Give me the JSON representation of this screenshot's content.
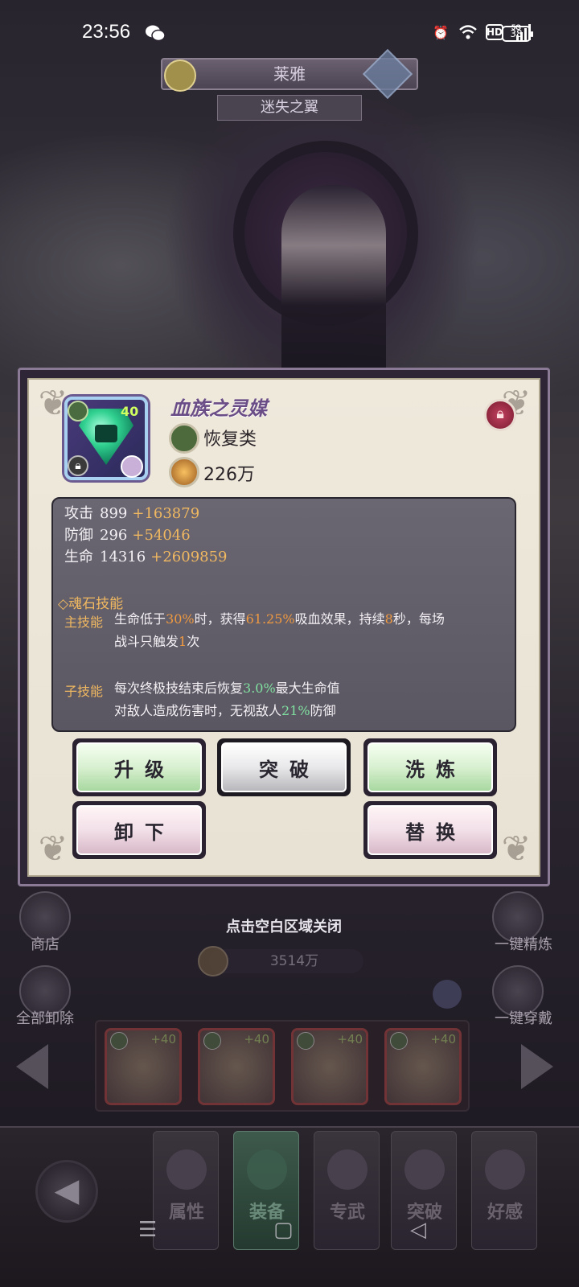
{
  "status_bar": {
    "time": "23:56",
    "battery": "38",
    "icons": [
      "wechat-icon",
      "alarm-icon",
      "wifi-icon",
      "hd-icon",
      "5g-signal-icon",
      "battery-icon"
    ]
  },
  "hero": {
    "name": "莱雅",
    "title": "迷失之翼"
  },
  "item": {
    "name": "血族之灵媒",
    "level": "40",
    "type": "恢复类",
    "power": "226万",
    "accent_color": "#6a4c86"
  },
  "stats": [
    {
      "label": "攻击",
      "base": "899",
      "bonus": "+163879"
    },
    {
      "label": "防御",
      "base": "296",
      "bonus": "+54046"
    },
    {
      "label": "生命",
      "base": "14316",
      "bonus": "+2609859"
    }
  ],
  "skills": {
    "section_title": "◇魂石技能",
    "main_label": "主技能",
    "main_parts": {
      "p1": "生命低于",
      "v1": "30%",
      "p2": "时，获得",
      "v2": "61.25%",
      "p3": "吸血效果，持续",
      "v3": "8",
      "p4": "秒，每场",
      "p5": "战斗只触发",
      "v4": "1",
      "p6": "次"
    },
    "sub_label": "子技能",
    "sub_parts": {
      "p1": "每次终极技结束后恢复",
      "v1": "3.0%",
      "p2": "最大生命值",
      "p3": "对敌人造成伤害时，无视敌人",
      "v2": "21%",
      "p4": "防御"
    }
  },
  "buttons": {
    "upgrade": "升级",
    "breakthrough": "突破",
    "refine": "洗炼",
    "unequip": "卸下",
    "replace": "替换"
  },
  "hint": "点击空白区域关闭",
  "side": {
    "shop": "商店",
    "remove_all": "全部卸除",
    "one_click_refine": "一键精炼",
    "one_click_equip": "一键穿戴"
  },
  "total_power": "3514万",
  "equip_slots": [
    {
      "level": "+40"
    },
    {
      "level": "+40"
    },
    {
      "level": "+40"
    },
    {
      "level": "+40"
    }
  ],
  "nav": {
    "tabs": [
      "属性",
      "装备",
      "专武",
      "突破",
      "好感"
    ],
    "active": "装备"
  }
}
